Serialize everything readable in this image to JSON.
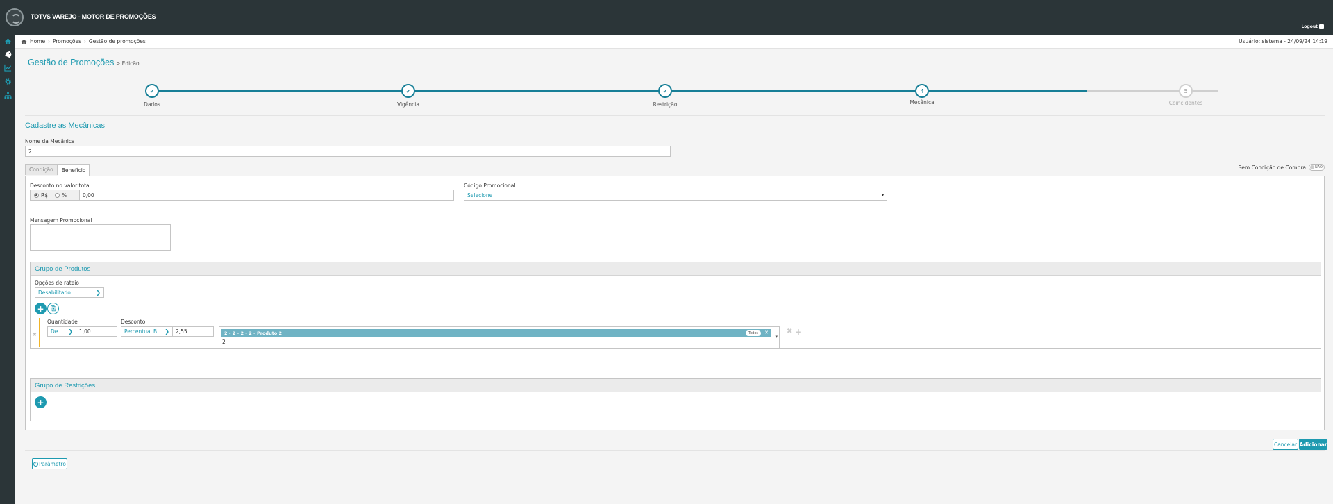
{
  "app": {
    "title": "TOTVS VAREJO - MOTOR DE PROMOÇÕES",
    "logout": "Logout"
  },
  "sidebar": {
    "icons": [
      "home-icon",
      "tag-icon",
      "chart-icon",
      "gear-icon",
      "sitemap-icon"
    ]
  },
  "breadcrumb": {
    "items": [
      "Home",
      "Promoções",
      "Gestão de promoções"
    ],
    "user_info": "Usuário: sistema - 24/09/24 14:19"
  },
  "page": {
    "title": "Gestão de Promoções",
    "subtitle": "> Edicão"
  },
  "stepper": {
    "steps": [
      {
        "label": "Dados",
        "state": "done"
      },
      {
        "label": "Vigência",
        "state": "done"
      },
      {
        "label": "Restrição",
        "state": "done"
      },
      {
        "label": "Mecânica",
        "state": "active",
        "number": "4"
      },
      {
        "label": "Coincidentes",
        "state": "pending",
        "number": "5"
      }
    ]
  },
  "form": {
    "section_title": "Cadastre as Mecânicas",
    "mechanic_name_label": "Nome da Mecânica",
    "mechanic_name_value": "2",
    "tabs": [
      "Condição",
      "Benefício"
    ],
    "sem_condicao_label": "Sem Condição de Compra",
    "toggle_value": "NÃO",
    "discount_label": "Desconto no valor total",
    "radio_rs": "R$",
    "radio_pct": "%",
    "discount_value": "0,00",
    "promo_code_label": "Código Promocional:",
    "promo_code_value": "Selecione",
    "message_label": "Mensagem Promocional"
  },
  "product_group": {
    "title": "Grupo de Produtos",
    "rateio_label": "Opções de rateio",
    "rateio_value": "Desabilitado",
    "quantity_label": "Quantidade",
    "discount_label": "Desconto",
    "quantity_operator": "De",
    "quantity_value": "1,00",
    "discount_type": "Percentual B",
    "discount_value": "2,55",
    "product_tag": "2 - 2 - 2 - 2 - Produto 2",
    "product_tag_pill": "Todos",
    "product_input": "2"
  },
  "restriction_group": {
    "title": "Grupo de Restrições"
  },
  "actions": {
    "cancel": "Cancelar",
    "add": "Adicionar",
    "parameter": "Parâmetro"
  },
  "colors": {
    "accent": "#1e9ab0",
    "topbar": "#2b3538",
    "step": "#177f97",
    "tag": "#6fb3c4"
  }
}
